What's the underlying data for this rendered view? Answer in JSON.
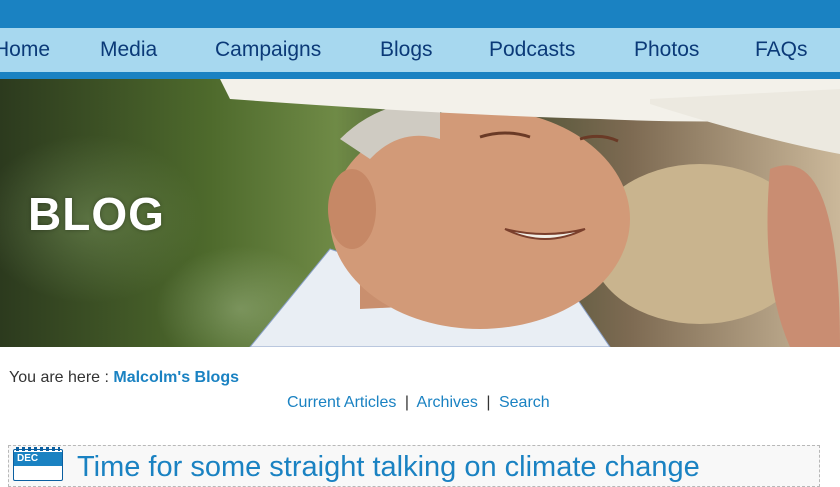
{
  "nav": {
    "items": [
      "Home",
      "Media",
      "Campaigns",
      "Blogs",
      "Podcasts",
      "Photos",
      "FAQs"
    ]
  },
  "hero": {
    "title": "BLOG"
  },
  "breadcrumb": {
    "prefix": "You are here : ",
    "link": "Malcolm's Blogs"
  },
  "subnav": {
    "current": "Current Articles",
    "archives": "Archives",
    "search": "Search",
    "separator": "|"
  },
  "post": {
    "month": "DEC",
    "title": "Time for some straight talking on climate change"
  },
  "colors": {
    "accent": "#1a82c2",
    "nav_bg": "#a7d8ef",
    "nav_text": "#0b3a78"
  }
}
